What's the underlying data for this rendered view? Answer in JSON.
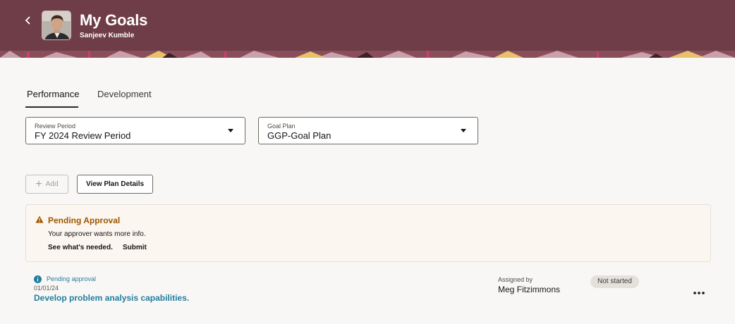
{
  "header": {
    "title": "My Goals",
    "user_name": "Sanjeev Kumble",
    "back_icon": "chevron-left-icon",
    "background_color": "#6f3d48"
  },
  "tabs": [
    {
      "label": "Performance",
      "active": true
    },
    {
      "label": "Development",
      "active": false
    }
  ],
  "filters": {
    "review_period": {
      "label": "Review Period",
      "value": "FY 2024 Review Period"
    },
    "goal_plan": {
      "label": "Goal Plan",
      "value": "GGP-Goal Plan"
    }
  },
  "toolbar": {
    "add_label": "Add",
    "add_enabled": false,
    "view_plan_label": "View Plan Details"
  },
  "pending_banner": {
    "title": "Pending Approval",
    "message": "Your approver wants more info.",
    "link_details": "See what's needed.",
    "link_submit": "Submit",
    "title_color": "#9e5600"
  },
  "goals": [
    {
      "status_text": "Pending approval",
      "date": "01/01/24",
      "title": "Develop problem analysis capabilities.",
      "assigned_by_label": "Assigned by",
      "assigned_by": "Meg Fitzimmons",
      "progress_status": "Not started"
    }
  ]
}
